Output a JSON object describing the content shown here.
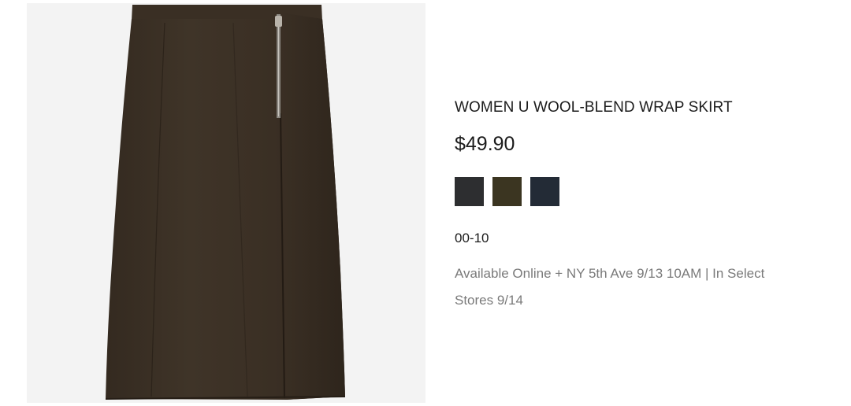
{
  "product": {
    "image_alt": "Women U wool-blend wrap skirt in dark olive brown",
    "title": "WOMEN U WOOL-BLEND WRAP SKIRT",
    "price": "$49.90",
    "sizes": "00-10",
    "availability": "Available Online + NY 5th Ave 9/13 10AM | In Select Stores 9/14",
    "swatches": [
      {
        "name": "dark-gray",
        "color": "#2d2e30"
      },
      {
        "name": "olive",
        "color": "#3b3521"
      },
      {
        "name": "navy",
        "color": "#232b36"
      }
    ]
  },
  "colors": {
    "image_background": "#f3f3f3",
    "skirt": "#3d3226",
    "title_text": "#1b1b1b",
    "availability_text": "#7a7a7a"
  }
}
